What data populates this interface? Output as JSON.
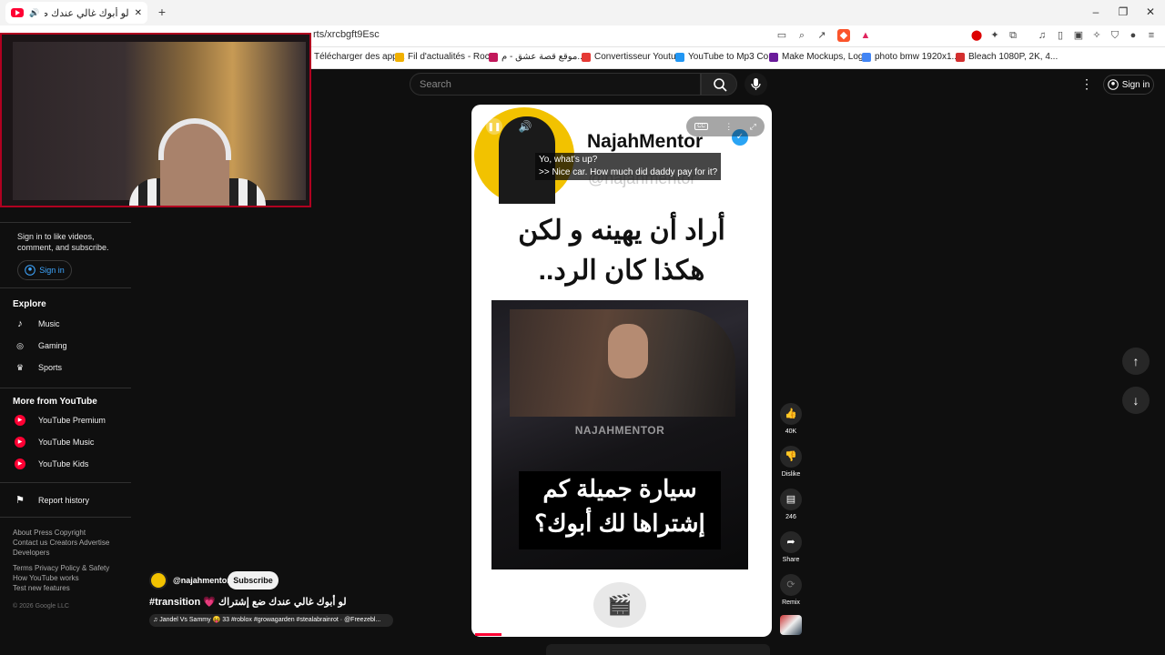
{
  "browser": {
    "tab_title": "لو أبوك غالي عندك ضع إشتراك",
    "new_tab": "+",
    "url": "rts/xrcbgft9Esc",
    "window_controls": {
      "minimize": "–",
      "restore": "❐",
      "close": "✕"
    },
    "bookmarks": [
      {
        "label": "Télécharger des app...",
        "color": "#e4572e"
      },
      {
        "label": "Fil d'actualités - Roc...",
        "color": "#f0b000"
      },
      {
        "label": "موقع قصة عشق - م...",
        "color": "#c2185b"
      },
      {
        "label": "Convertisseur Youtu...",
        "color": "#e53935"
      },
      {
        "label": "YouTube to Mp3 Co...",
        "color": "#2196f3"
      },
      {
        "label": "Make Mockups, Log...",
        "color": "#6a1b9a"
      },
      {
        "label": "photo bmw 1920x1...",
        "color": "#4285f4"
      },
      {
        "label": "Bleach 1080P, 2K, 4...",
        "color": "#d32f2f"
      }
    ]
  },
  "header": {
    "search_placeholder": "Search",
    "more_icon": "⋮",
    "sign_in": "Sign in"
  },
  "sidebar": {
    "signin_prompt": "Sign in to like videos, comment, and subscribe.",
    "signin_button": "Sign in",
    "explore_heading": "Explore",
    "explore_items": [
      {
        "label": "Music",
        "icon": "♪"
      },
      {
        "label": "Gaming",
        "icon": "🎮"
      },
      {
        "label": "Sports",
        "icon": "🏆"
      }
    ],
    "more_heading": "More from YouTube",
    "more_items": [
      {
        "label": "YouTube Premium"
      },
      {
        "label": "YouTube Music"
      },
      {
        "label": "YouTube Kids"
      }
    ],
    "report_history": "Report history",
    "footer_line1": "About  Press  Copyright",
    "footer_line2": "Contact us  Creators  Advertise",
    "footer_line3": "Developers",
    "footer_line4": "Terms  Privacy  Policy & Safety",
    "footer_line5": "How YouTube works",
    "footer_line6": "Test new features",
    "copyright": "© 2026 Google LLC"
  },
  "player": {
    "brand": "NajahMentor",
    "handle": "@najahmentor",
    "caption_text": "Yo, what's up?\n>> Nice car. How much did daddy pay for it?",
    "cc_label": "CC",
    "title_ar_line1": "أراد أن يهينه و لكن",
    "title_ar_line2": "هكذا كان الرد..",
    "watermark": "NAJAHMENTOR",
    "subtitle_ar_line1": "سيارة جميلة كم",
    "subtitle_ar_line2": "إشتراها لك أبوك؟",
    "progress": 0.09
  },
  "actions": {
    "likes": "40K",
    "dislike": "Dislike",
    "comments": "246",
    "share": "Share",
    "remix": "Remix"
  },
  "channel": {
    "name": "@najahmentor",
    "subscribe": "Subscribe",
    "title": "#transition 💗 لو أبوك غالي عندك ضع إشتراك",
    "music": "♫ Jandel Vs Sammy 😝 33 #roblox #growagarden #stealabrainrot · @Freezebl..."
  }
}
